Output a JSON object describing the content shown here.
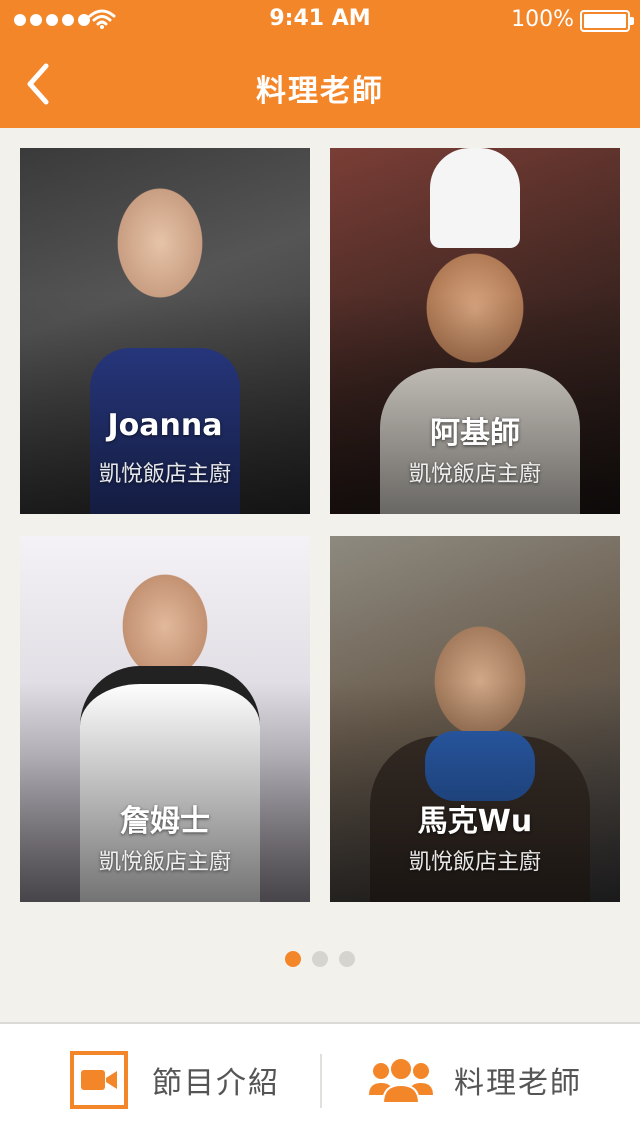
{
  "status_bar": {
    "time": "9:41 AM",
    "battery": "100%",
    "signal_icon": "signal-dots-icon",
    "wifi_icon": "wifi-icon",
    "battery_icon": "battery-icon"
  },
  "nav": {
    "title": "料理老師",
    "back_icon": "chevron-left-icon"
  },
  "teachers": [
    {
      "name": "Joanna",
      "title": "凱悅飯店主廚"
    },
    {
      "name": "阿基師",
      "title": "凱悅飯店主廚"
    },
    {
      "name": "詹姆士",
      "title": "凱悅飯店主廚"
    },
    {
      "name": "馬克Wu",
      "title": "凱悅飯店主廚"
    }
  ],
  "pagination": {
    "pages": 3,
    "current": 1
  },
  "tabbar": {
    "tabs": [
      {
        "label": "節目介紹",
        "icon": "video-camera-icon"
      },
      {
        "label": "料理老師",
        "icon": "people-icon"
      }
    ]
  },
  "colors": {
    "accent": "#f4862a",
    "background": "#f3f1ec",
    "tab_text": "#555555"
  }
}
